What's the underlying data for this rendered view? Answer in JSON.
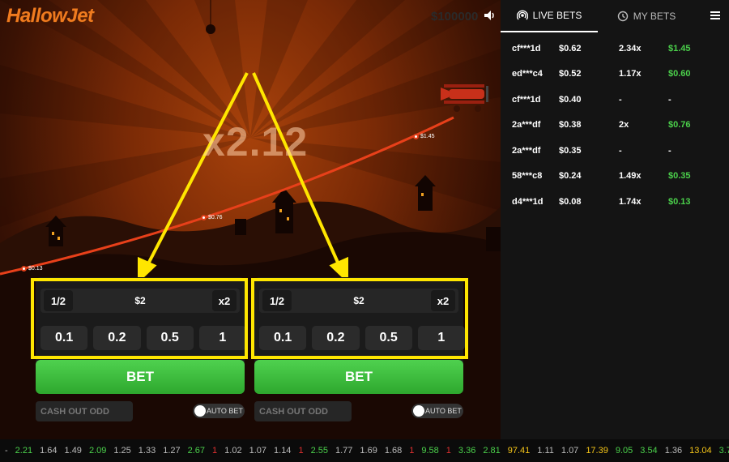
{
  "game": {
    "logo": "HallowJet",
    "balance": "$100000",
    "multiplier": "x2.12",
    "markers": [
      {
        "label": "$0.13"
      },
      {
        "label": "$0.76"
      },
      {
        "label": "$1.45"
      }
    ]
  },
  "panels": [
    {
      "half": "1/2",
      "amount": "$2",
      "double": "x2",
      "chips": [
        "0.1",
        "0.2",
        "0.5",
        "1"
      ],
      "bet": "BET",
      "cashout_placeholder": "CASH OUT ODD",
      "autobet": "AUTO BET"
    },
    {
      "half": "1/2",
      "amount": "$2",
      "double": "x2",
      "chips": [
        "0.1",
        "0.2",
        "0.5",
        "1"
      ],
      "bet": "BET",
      "cashout_placeholder": "CASH OUT ODD",
      "autobet": "AUTO BET"
    }
  ],
  "side": {
    "tabs": [
      {
        "label": "LIVE BETS",
        "icon": "broadcast-icon"
      },
      {
        "label": "MY BETS",
        "icon": "history-icon"
      }
    ],
    "bets": [
      {
        "user": "cf***1d",
        "amount": "$0.62",
        "multiplier": "2.34x",
        "win": "$1.45"
      },
      {
        "user": "ed***c4",
        "amount": "$0.52",
        "multiplier": "1.17x",
        "win": "$0.60"
      },
      {
        "user": "cf***1d",
        "amount": "$0.40",
        "multiplier": "-",
        "win": "-"
      },
      {
        "user": "2a***df",
        "amount": "$0.38",
        "multiplier": "2x",
        "win": "$0.76"
      },
      {
        "user": "2a***df",
        "amount": "$0.35",
        "multiplier": "-",
        "win": "-"
      },
      {
        "user": "58***c8",
        "amount": "$0.24",
        "multiplier": "1.49x",
        "win": "$0.35"
      },
      {
        "user": "d4***1d",
        "amount": "$0.08",
        "multiplier": "1.74x",
        "win": "$0.13"
      }
    ]
  },
  "history": [
    {
      "v": "-",
      "c": "#bbbbbb"
    },
    {
      "v": "2.21",
      "c": "#4bd04b"
    },
    {
      "v": "1.64",
      "c": "#bbbbbb"
    },
    {
      "v": "1.49",
      "c": "#bbbbbb"
    },
    {
      "v": "2.09",
      "c": "#4bd04b"
    },
    {
      "v": "1.25",
      "c": "#bbbbbb"
    },
    {
      "v": "1.33",
      "c": "#bbbbbb"
    },
    {
      "v": "1.27",
      "c": "#bbbbbb"
    },
    {
      "v": "2.67",
      "c": "#4bd04b"
    },
    {
      "v": "1",
      "c": "#e03030"
    },
    {
      "v": "1.02",
      "c": "#bbbbbb"
    },
    {
      "v": "1.07",
      "c": "#bbbbbb"
    },
    {
      "v": "1.14",
      "c": "#bbbbbb"
    },
    {
      "v": "1",
      "c": "#e03030"
    },
    {
      "v": "2.55",
      "c": "#4bd04b"
    },
    {
      "v": "1.77",
      "c": "#bbbbbb"
    },
    {
      "v": "1.69",
      "c": "#bbbbbb"
    },
    {
      "v": "1.68",
      "c": "#bbbbbb"
    },
    {
      "v": "1",
      "c": "#e03030"
    },
    {
      "v": "9.58",
      "c": "#4bd04b"
    },
    {
      "v": "1",
      "c": "#e03030"
    },
    {
      "v": "3.36",
      "c": "#4bd04b"
    },
    {
      "v": "2.81",
      "c": "#4bd04b"
    },
    {
      "v": "97.41",
      "c": "#f5c518"
    },
    {
      "v": "1.11",
      "c": "#bbbbbb"
    },
    {
      "v": "1.07",
      "c": "#bbbbbb"
    },
    {
      "v": "17.39",
      "c": "#f5c518"
    },
    {
      "v": "9.05",
      "c": "#4bd04b"
    },
    {
      "v": "3.54",
      "c": "#4bd04b"
    },
    {
      "v": "1.36",
      "c": "#bbbbbb"
    },
    {
      "v": "13.04",
      "c": "#f5c518"
    },
    {
      "v": "3.7",
      "c": "#4bd04b"
    }
  ],
  "colors": {
    "accent": "#f07b1f",
    "highlight": "#ffe600",
    "bet_green": "#3cbf3c"
  }
}
